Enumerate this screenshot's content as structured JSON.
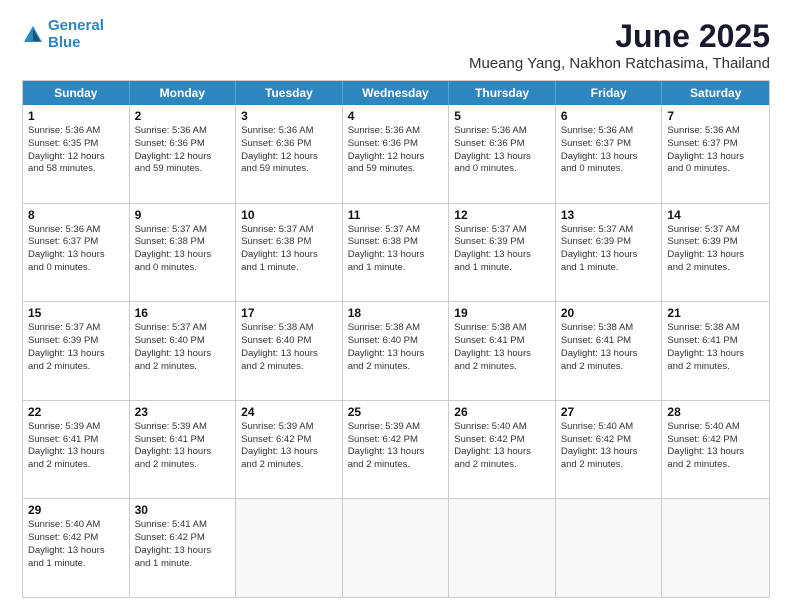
{
  "logo": {
    "line1": "General",
    "line2": "Blue"
  },
  "title": "June 2025",
  "subtitle": "Mueang Yang, Nakhon Ratchasima, Thailand",
  "header_days": [
    "Sunday",
    "Monday",
    "Tuesday",
    "Wednesday",
    "Thursday",
    "Friday",
    "Saturday"
  ],
  "weeks": [
    [
      {
        "day": "1",
        "lines": [
          "Sunrise: 5:36 AM",
          "Sunset: 6:35 PM",
          "Daylight: 12 hours",
          "and 58 minutes."
        ]
      },
      {
        "day": "2",
        "lines": [
          "Sunrise: 5:36 AM",
          "Sunset: 6:36 PM",
          "Daylight: 12 hours",
          "and 59 minutes."
        ]
      },
      {
        "day": "3",
        "lines": [
          "Sunrise: 5:36 AM",
          "Sunset: 6:36 PM",
          "Daylight: 12 hours",
          "and 59 minutes."
        ]
      },
      {
        "day": "4",
        "lines": [
          "Sunrise: 5:36 AM",
          "Sunset: 6:36 PM",
          "Daylight: 12 hours",
          "and 59 minutes."
        ]
      },
      {
        "day": "5",
        "lines": [
          "Sunrise: 5:36 AM",
          "Sunset: 6:36 PM",
          "Daylight: 13 hours",
          "and 0 minutes."
        ]
      },
      {
        "day": "6",
        "lines": [
          "Sunrise: 5:36 AM",
          "Sunset: 6:37 PM",
          "Daylight: 13 hours",
          "and 0 minutes."
        ]
      },
      {
        "day": "7",
        "lines": [
          "Sunrise: 5:36 AM",
          "Sunset: 6:37 PM",
          "Daylight: 13 hours",
          "and 0 minutes."
        ]
      }
    ],
    [
      {
        "day": "8",
        "lines": [
          "Sunrise: 5:36 AM",
          "Sunset: 6:37 PM",
          "Daylight: 13 hours",
          "and 0 minutes."
        ]
      },
      {
        "day": "9",
        "lines": [
          "Sunrise: 5:37 AM",
          "Sunset: 6:38 PM",
          "Daylight: 13 hours",
          "and 0 minutes."
        ]
      },
      {
        "day": "10",
        "lines": [
          "Sunrise: 5:37 AM",
          "Sunset: 6:38 PM",
          "Daylight: 13 hours",
          "and 1 minute."
        ]
      },
      {
        "day": "11",
        "lines": [
          "Sunrise: 5:37 AM",
          "Sunset: 6:38 PM",
          "Daylight: 13 hours",
          "and 1 minute."
        ]
      },
      {
        "day": "12",
        "lines": [
          "Sunrise: 5:37 AM",
          "Sunset: 6:39 PM",
          "Daylight: 13 hours",
          "and 1 minute."
        ]
      },
      {
        "day": "13",
        "lines": [
          "Sunrise: 5:37 AM",
          "Sunset: 6:39 PM",
          "Daylight: 13 hours",
          "and 1 minute."
        ]
      },
      {
        "day": "14",
        "lines": [
          "Sunrise: 5:37 AM",
          "Sunset: 6:39 PM",
          "Daylight: 13 hours",
          "and 2 minutes."
        ]
      }
    ],
    [
      {
        "day": "15",
        "lines": [
          "Sunrise: 5:37 AM",
          "Sunset: 6:39 PM",
          "Daylight: 13 hours",
          "and 2 minutes."
        ]
      },
      {
        "day": "16",
        "lines": [
          "Sunrise: 5:37 AM",
          "Sunset: 6:40 PM",
          "Daylight: 13 hours",
          "and 2 minutes."
        ]
      },
      {
        "day": "17",
        "lines": [
          "Sunrise: 5:38 AM",
          "Sunset: 6:40 PM",
          "Daylight: 13 hours",
          "and 2 minutes."
        ]
      },
      {
        "day": "18",
        "lines": [
          "Sunrise: 5:38 AM",
          "Sunset: 6:40 PM",
          "Daylight: 13 hours",
          "and 2 minutes."
        ]
      },
      {
        "day": "19",
        "lines": [
          "Sunrise: 5:38 AM",
          "Sunset: 6:41 PM",
          "Daylight: 13 hours",
          "and 2 minutes."
        ]
      },
      {
        "day": "20",
        "lines": [
          "Sunrise: 5:38 AM",
          "Sunset: 6:41 PM",
          "Daylight: 13 hours",
          "and 2 minutes."
        ]
      },
      {
        "day": "21",
        "lines": [
          "Sunrise: 5:38 AM",
          "Sunset: 6:41 PM",
          "Daylight: 13 hours",
          "and 2 minutes."
        ]
      }
    ],
    [
      {
        "day": "22",
        "lines": [
          "Sunrise: 5:39 AM",
          "Sunset: 6:41 PM",
          "Daylight: 13 hours",
          "and 2 minutes."
        ]
      },
      {
        "day": "23",
        "lines": [
          "Sunrise: 5:39 AM",
          "Sunset: 6:41 PM",
          "Daylight: 13 hours",
          "and 2 minutes."
        ]
      },
      {
        "day": "24",
        "lines": [
          "Sunrise: 5:39 AM",
          "Sunset: 6:42 PM",
          "Daylight: 13 hours",
          "and 2 minutes."
        ]
      },
      {
        "day": "25",
        "lines": [
          "Sunrise: 5:39 AM",
          "Sunset: 6:42 PM",
          "Daylight: 13 hours",
          "and 2 minutes."
        ]
      },
      {
        "day": "26",
        "lines": [
          "Sunrise: 5:40 AM",
          "Sunset: 6:42 PM",
          "Daylight: 13 hours",
          "and 2 minutes."
        ]
      },
      {
        "day": "27",
        "lines": [
          "Sunrise: 5:40 AM",
          "Sunset: 6:42 PM",
          "Daylight: 13 hours",
          "and 2 minutes."
        ]
      },
      {
        "day": "28",
        "lines": [
          "Sunrise: 5:40 AM",
          "Sunset: 6:42 PM",
          "Daylight: 13 hours",
          "and 2 minutes."
        ]
      }
    ],
    [
      {
        "day": "29",
        "lines": [
          "Sunrise: 5:40 AM",
          "Sunset: 6:42 PM",
          "Daylight: 13 hours",
          "and 1 minute."
        ]
      },
      {
        "day": "30",
        "lines": [
          "Sunrise: 5:41 AM",
          "Sunset: 6:42 PM",
          "Daylight: 13 hours",
          "and 1 minute."
        ]
      },
      {
        "day": "",
        "lines": []
      },
      {
        "day": "",
        "lines": []
      },
      {
        "day": "",
        "lines": []
      },
      {
        "day": "",
        "lines": []
      },
      {
        "day": "",
        "lines": []
      }
    ]
  ]
}
